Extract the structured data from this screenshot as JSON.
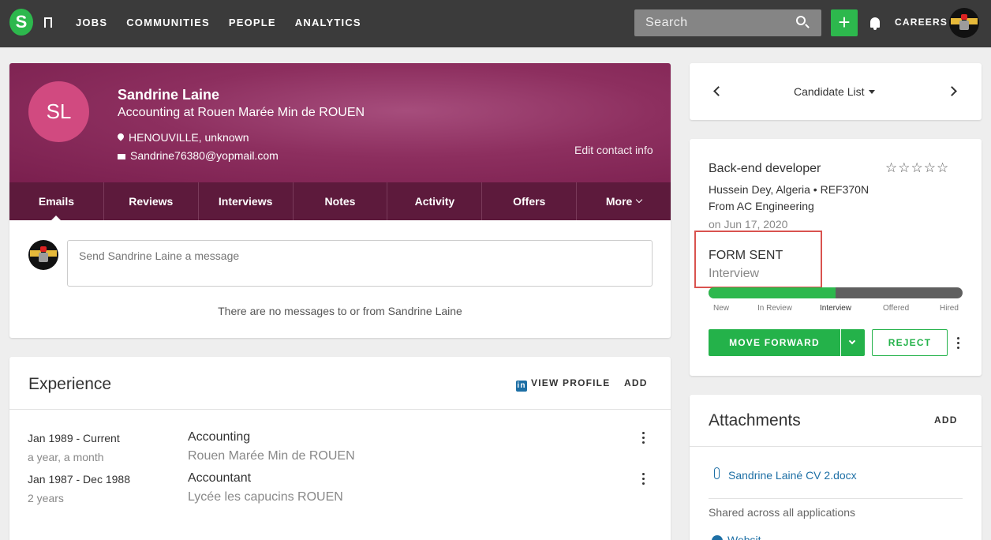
{
  "nav": {
    "logo": "S",
    "links": [
      "JOBS",
      "COMMUNITIES",
      "PEOPLE",
      "ANALYTICS"
    ],
    "search_placeholder": "Search",
    "plus": "+",
    "careers": "CAREERS"
  },
  "candidate": {
    "initials": "SL",
    "name": "Sandrine Laine",
    "title": "Accounting at Rouen Marée Min de ROUEN",
    "location": "HENOUVILLE, unknown",
    "email": "Sandrine76380@yopmail.com",
    "edit_contact": "Edit contact info"
  },
  "tabs": [
    {
      "label": "Emails",
      "active": true
    },
    {
      "label": "Reviews"
    },
    {
      "label": "Interviews"
    },
    {
      "label": "Notes"
    },
    {
      "label": "Activity"
    },
    {
      "label": "Offers"
    },
    {
      "label": "More"
    }
  ],
  "messages": {
    "placeholder": "Send Sandrine Laine a message",
    "empty": "There are no messages to or from Sandrine Laine"
  },
  "experience": {
    "title": "Experience",
    "view_profile": "VIEW PROFILE",
    "linkedin": "in",
    "add": "ADD",
    "entries": [
      {
        "dates": "Jan 1989 - Current",
        "duration": "a year, a month",
        "role": "Accounting",
        "org": "Rouen Marée Min de ROUEN"
      },
      {
        "dates": "Jan 1987 - Dec 1988",
        "duration": "2 years",
        "role": "Accountant",
        "org": "Lycée les capucins ROUEN"
      }
    ]
  },
  "candidate_nav": {
    "label": "Candidate List"
  },
  "application": {
    "job_title": "Back-end developer",
    "stars": "☆☆☆☆☆",
    "location_ref": "Hussein Dey, Algeria  •  REF370N",
    "from": "From AC Engineering",
    "date": "on Jun 17, 2020",
    "status": "FORM SENT",
    "stage": "Interview",
    "progress": 0.5,
    "stages": [
      "New",
      "In Review",
      "Interview",
      "Offered",
      "Hired"
    ],
    "move_forward": "MOVE FORWARD",
    "reject": "REJECT"
  },
  "attachments": {
    "title": "Attachments",
    "add": "ADD",
    "file": "Sandrine Lainé CV 2.docx",
    "shared": "Shared across all applications",
    "next_label": "Websit"
  },
  "colors": {
    "accent_green": "#2db84d",
    "header_maroon": "#8d2f5f",
    "tabs_bg": "#5d1a3c",
    "link_blue": "#1d6fa5",
    "highlight_red": "#d9534f"
  }
}
